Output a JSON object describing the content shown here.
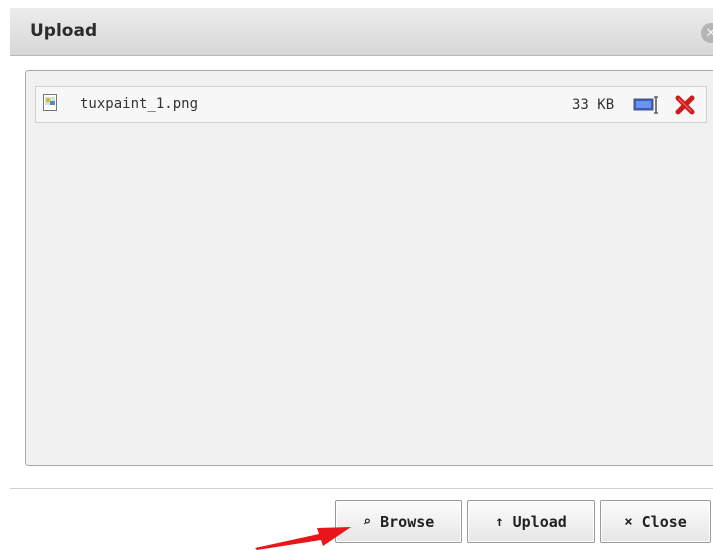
{
  "dialog": {
    "title": "Upload",
    "close_icon": "close-circle-icon"
  },
  "file": {
    "name": "tuxpaint_1.png",
    "size": "33 KB",
    "type_icon": "image-file-icon",
    "preview_icon": "preview-icon",
    "remove_icon": "remove-x-icon"
  },
  "buttons": {
    "browse": {
      "icon": "⌕",
      "label": "Browse"
    },
    "upload": {
      "icon": "↑",
      "label": "Upload"
    },
    "close": {
      "icon": "×",
      "label": "Close"
    }
  },
  "colors": {
    "remove": "#cc1b1b",
    "annotation_arrow": "#e8151a"
  }
}
